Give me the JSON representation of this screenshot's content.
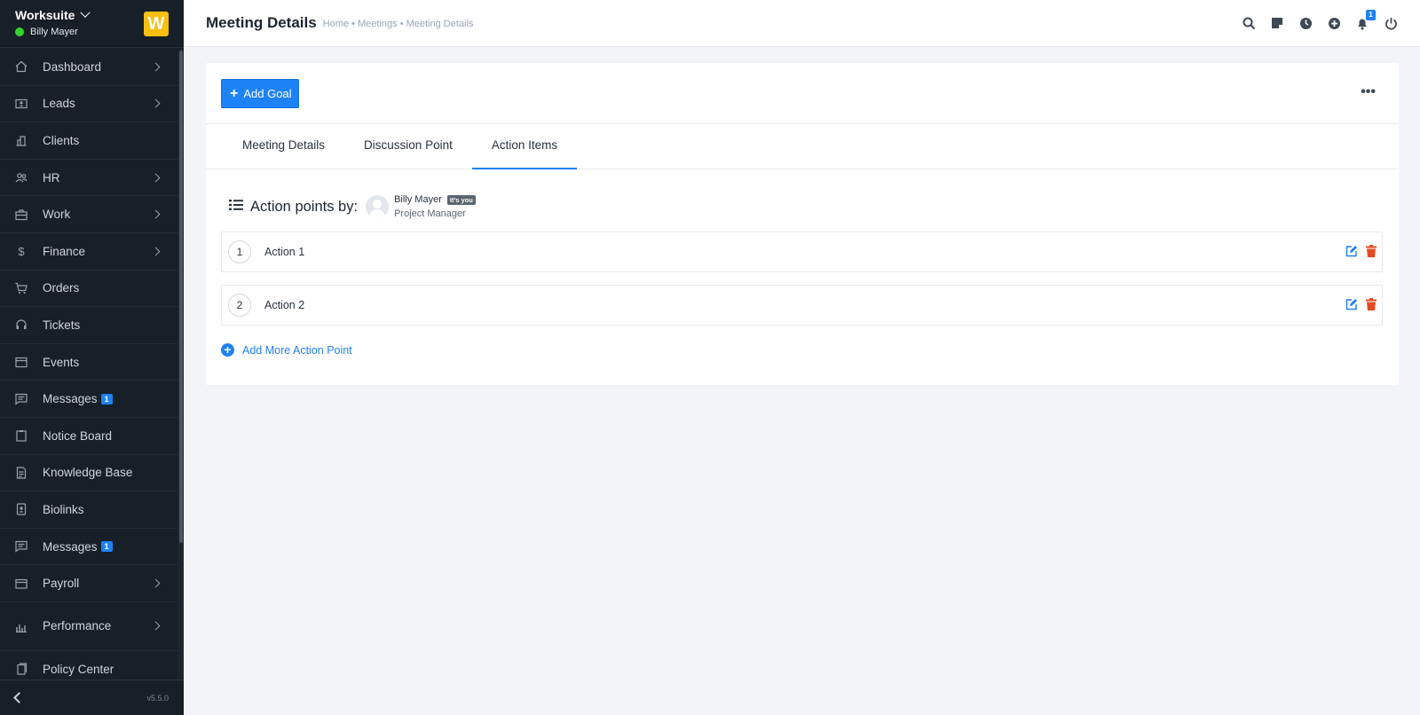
{
  "app": {
    "company": "Worksuite",
    "user": "Billy Mayer",
    "logo_letter": "W",
    "version": "v5.5.0"
  },
  "sidebar": {
    "items": [
      {
        "label": "Dashboard",
        "icon": "house-icon",
        "arrow": true
      },
      {
        "label": "Leads",
        "icon": "contact-card-icon",
        "arrow": true
      },
      {
        "label": "Clients",
        "icon": "building-icon",
        "arrow": false
      },
      {
        "label": "HR",
        "icon": "people-icon",
        "arrow": true
      },
      {
        "label": "Work",
        "icon": "briefcase-icon",
        "arrow": true
      },
      {
        "label": "Finance",
        "icon": "dollar-icon",
        "arrow": true
      },
      {
        "label": "Orders",
        "icon": "cart-icon",
        "arrow": false
      },
      {
        "label": "Tickets",
        "icon": "headset-icon",
        "arrow": false
      },
      {
        "label": "Events",
        "icon": "calendar-icon",
        "arrow": false
      },
      {
        "label": "Messages",
        "icon": "chat-icon",
        "arrow": false,
        "badge": "1"
      },
      {
        "label": "Notice Board",
        "icon": "clipboard-icon",
        "arrow": false
      },
      {
        "label": "Knowledge Base",
        "icon": "document-icon",
        "arrow": false
      },
      {
        "label": "Biolinks",
        "icon": "id-badge-icon",
        "arrow": false
      },
      {
        "label": "Messages",
        "icon": "chat-icon",
        "arrow": false,
        "badge": "1"
      },
      {
        "label": "Payroll",
        "icon": "wallet-icon",
        "arrow": true
      },
      {
        "label": "Performance",
        "icon": "bar-chart-icon",
        "arrow": true
      },
      {
        "label": "Policy Center",
        "icon": "files-icon",
        "arrow": false
      }
    ]
  },
  "header": {
    "title": "Meeting Details",
    "breadcrumb": "Home • Meetings • Meeting Details",
    "notification_count": "1"
  },
  "card": {
    "add_goal_label": "Add Goal",
    "more_label": "•••",
    "tabs": [
      {
        "label": "Meeting Details",
        "active": false
      },
      {
        "label": "Discussion Point",
        "active": false
      },
      {
        "label": "Action Items",
        "active": true
      }
    ],
    "action_points": {
      "heading": "Action points by:",
      "owner_name": "Billy Mayer",
      "owner_badge": "It's you",
      "owner_role": "Project Manager",
      "items": [
        {
          "number": "1",
          "text": "Action 1"
        },
        {
          "number": "2",
          "text": "Action 2"
        }
      ],
      "add_more_label": "Add More Action Point"
    }
  },
  "colors": {
    "sidebar_bg": "#171f29",
    "accent": "#1d82f5",
    "delete": "#e44b22",
    "logo": "#f8bf11"
  }
}
